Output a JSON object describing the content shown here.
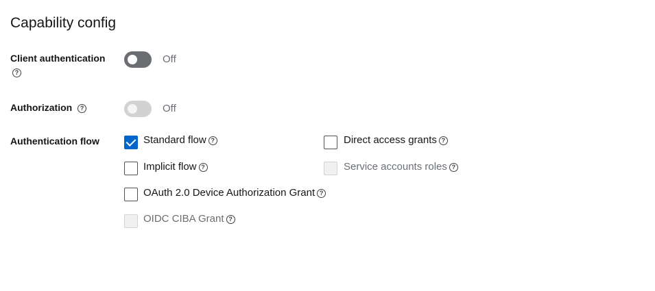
{
  "section": {
    "title": "Capability config"
  },
  "client_authentication": {
    "label": "Client authentication",
    "state_text": "Off"
  },
  "authorization": {
    "label": "Authorization",
    "state_text": "Off"
  },
  "authentication_flow": {
    "label": "Authentication flow",
    "options": {
      "standard_flow": {
        "label": "Standard flow",
        "checked": true
      },
      "direct_access_grants": {
        "label": "Direct access grants",
        "checked": false
      },
      "implicit_flow": {
        "label": "Implicit flow",
        "checked": false
      },
      "service_accounts_roles": {
        "label": "Service accounts roles",
        "checked": false,
        "disabled": true
      },
      "oauth_device_grant": {
        "label": "OAuth 2.0 Device Authorization Grant",
        "checked": false
      },
      "oidc_ciba_grant": {
        "label": "OIDC CIBA Grant",
        "checked": false,
        "disabled": true
      }
    }
  },
  "help_icon": {
    "glyph": "?",
    "icon": "question-circle-icon"
  },
  "colors": {
    "accent": "#0066cc",
    "toggle_off": "#6a6e73",
    "toggle_disabled": "#d2d2d2"
  }
}
